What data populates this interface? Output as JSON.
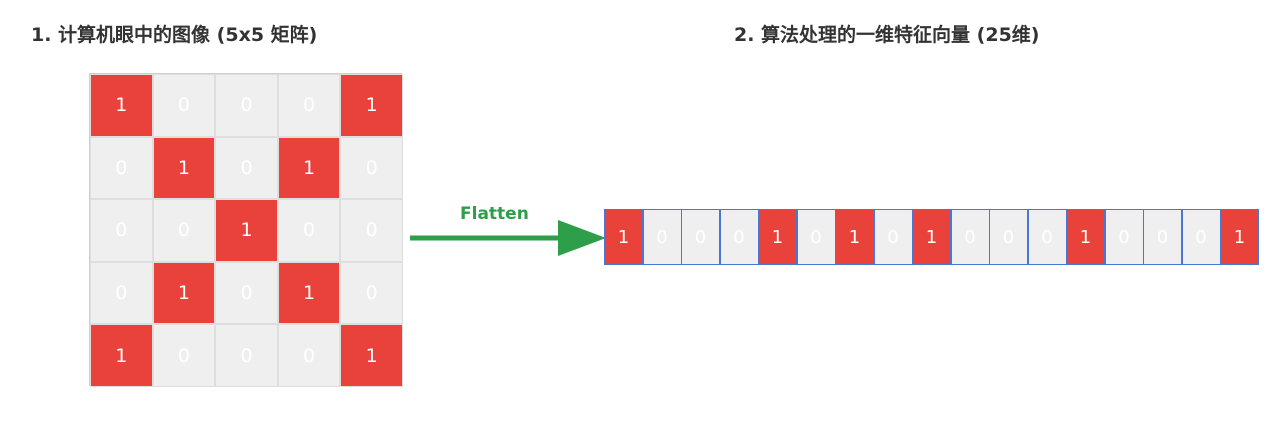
{
  "left_title": "1. 计算机眼中的图像 (5x5 矩阵)",
  "right_title": "2. 算法处理的一维特征向量 (25维)",
  "flatten_label": "Flatten",
  "colors": {
    "on": "#e8423a",
    "off": "#efefef",
    "arrow": "#2e9e4a",
    "vector_border": "#4a77d4"
  },
  "matrix": [
    [
      "1",
      "0",
      "0",
      "0",
      "1"
    ],
    [
      "0",
      "1",
      "0",
      "1",
      "0"
    ],
    [
      "0",
      "0",
      "1",
      "0",
      "0"
    ],
    [
      "0",
      "1",
      "0",
      "1",
      "0"
    ],
    [
      "1",
      "0",
      "0",
      "0",
      "1"
    ]
  ],
  "vector": [
    "1",
    "0",
    "0",
    "0",
    "1",
    "0",
    "1",
    "0",
    "1",
    "0",
    "0",
    "0",
    "1",
    "0",
    "0",
    "0",
    "1"
  ]
}
